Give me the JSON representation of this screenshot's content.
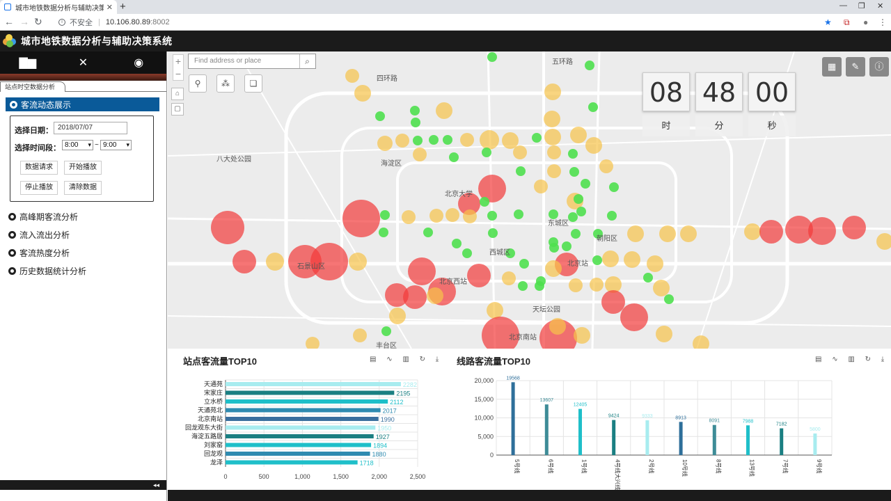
{
  "browser": {
    "tab_title": "城市地铁数据分析与辅助决策系...",
    "url_insecure": "不安全",
    "url_host": "10.106.80.89",
    "url_port": ":8002"
  },
  "app": {
    "title": "城市地铁数据分析与辅助决策系统"
  },
  "sidebar": {
    "subtab": "站点时空数据分析",
    "active_menu": "客流动态展示",
    "date_label": "选择日期：",
    "date_value": "2018/07/07",
    "time_label": "选择时间段：",
    "time_start": "8:00",
    "time_sep": "~",
    "time_end": "9:00",
    "buttons": [
      "数据请求",
      "开始播放",
      "停止播放",
      "清除数据"
    ],
    "menu_items": [
      "高峰期客流分析",
      "流入流出分析",
      "客流热度分析",
      "历史数据统计分析"
    ],
    "collapse": "◂◂"
  },
  "map": {
    "search_placeholder": "Find address or place",
    "clock": {
      "hour": "08",
      "minute": "48",
      "second": "00",
      "hour_label": "时",
      "minute_label": "分",
      "second_label": "秒"
    },
    "labels": [
      "海淀区",
      "东城区",
      "西城区",
      "朝阳区",
      "石景山区",
      "丰台区",
      "北京站",
      "北京南站",
      "天坛公园",
      "北京大学",
      "八大处公园",
      "北京西站",
      "五环路",
      "四环路"
    ]
  },
  "charts": {
    "station_title": "站点客流量TOP10",
    "line_title": "线路客流量TOP10",
    "tools": "▤ ∿ ▥ ↻ ⤓"
  },
  "chart_data": [
    {
      "type": "bar",
      "orientation": "horizontal",
      "title": "站点客流量TOP10",
      "categories": [
        "天通苑",
        "宋家庄",
        "立水桥",
        "天通苑北",
        "北京南站",
        "回龙观东大街",
        "海淀五路居",
        "刘家窑",
        "回龙观",
        "龙泽"
      ],
      "values": [
        2282,
        2195,
        2112,
        2017,
        1990,
        1950,
        1927,
        1894,
        1880,
        1718
      ],
      "xlim": [
        0,
        2500
      ],
      "xticks": [
        "0",
        "500",
        "1,000",
        "1,500",
        "2,000",
        "2,500"
      ],
      "colors": [
        "#a8ecef",
        "#1a7f82",
        "#1fbfc9",
        "#2f8bb0",
        "#3a6f9e",
        "#a8ecef",
        "#1a7f82",
        "#1fbfc9",
        "#2f8bb0",
        "#1fbfc9"
      ]
    },
    {
      "type": "bar",
      "title": "线路客流量TOP10",
      "categories": [
        "5号线",
        "6号线",
        "1号线",
        "4号线大兴线",
        "2号线",
        "10号线",
        "8号线",
        "13号线",
        "7号线",
        "9号线"
      ],
      "values": [
        19568,
        13607,
        12405,
        9424,
        9333,
        8913,
        8091,
        7988,
        7182,
        5800
      ],
      "ylim": [
        0,
        20000
      ],
      "yticks": [
        "0",
        "5,000",
        "10,000",
        "15,000",
        "20,000"
      ],
      "colors": [
        "#2e6f9a",
        "#3e8c97",
        "#1fbfc9",
        "#1a7f82",
        "#a8ecef",
        "#2e6f9a",
        "#3e8c97",
        "#1fbfc9",
        "#1a7f82",
        "#a8ecef"
      ]
    }
  ],
  "colors": {
    "header_bg": "#1b1b1b",
    "active_menu_bg": "#0a5a99",
    "bubble_low": "#4fe04f",
    "bubble_mid": "#f7c34a",
    "bubble_high": "#f23a3a"
  }
}
